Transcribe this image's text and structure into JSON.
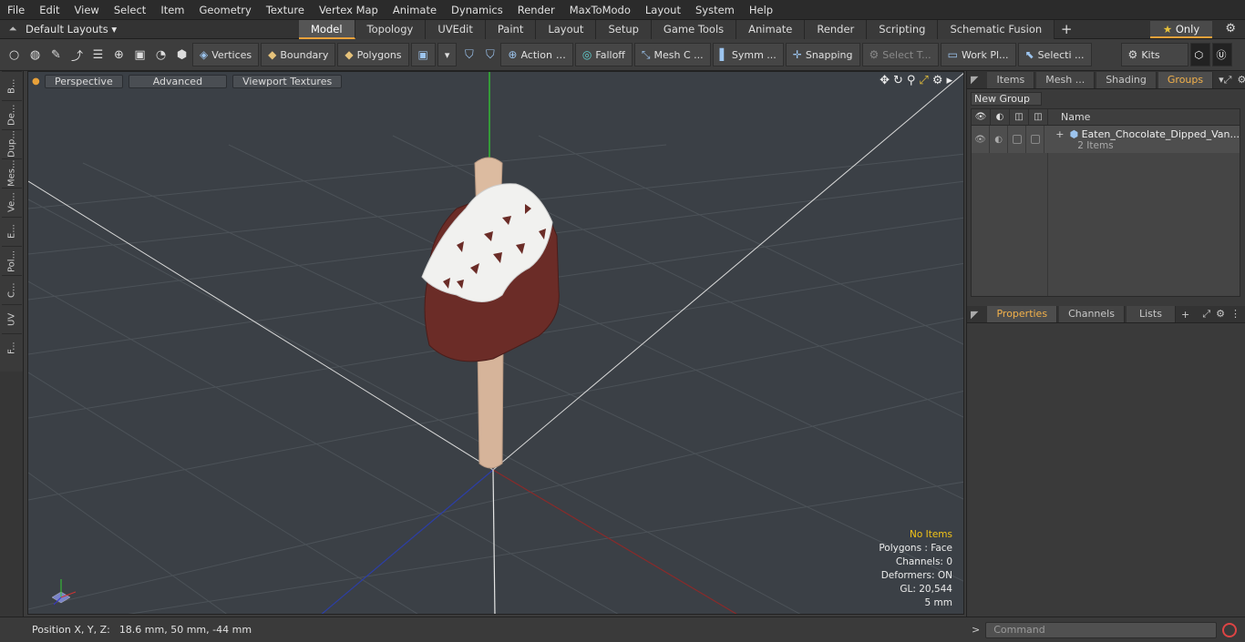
{
  "menu": [
    "File",
    "Edit",
    "View",
    "Select",
    "Item",
    "Geometry",
    "Texture",
    "Vertex Map",
    "Animate",
    "Dynamics",
    "Render",
    "MaxToModo",
    "Layout",
    "System",
    "Help"
  ],
  "layoutbar": {
    "layouts_label": "Default Layouts",
    "tabs": [
      "Model",
      "Topology",
      "UVEdit",
      "Paint",
      "Layout",
      "Setup",
      "Game Tools",
      "Animate",
      "Render",
      "Scripting",
      "Schematic Fusion"
    ],
    "active_tab": "Model",
    "only_label": "Only"
  },
  "toolbar": {
    "vertices": "Vertices",
    "boundary": "Boundary",
    "polygons": "Polygons",
    "action": "Action",
    "falloff": "Falloff",
    "mesh": "Mesh C ...",
    "symm": "Symm ...",
    "snapping": "Snapping",
    "select_t": "Select T...",
    "workpl": "Work Pl...",
    "selecti": "Selecti ...",
    "kits": "Kits"
  },
  "left_tabs": [
    "B...",
    "De...",
    "Dup...",
    "Mes...",
    "Ve...",
    "E...",
    "Pol...",
    "C...",
    "UV",
    "F..."
  ],
  "viewport": {
    "perspective": "Perspective",
    "advanced": "Advanced",
    "textures": "Viewport Textures",
    "info": {
      "items": "No Items",
      "polygons": "Polygons : Face",
      "channels": "Channels: 0",
      "deformers": "Deformers: ON",
      "gl": "GL: 20,544",
      "scale": "5 mm"
    }
  },
  "status": {
    "label": "Position X, Y, Z:",
    "value": "18.6 mm, 50 mm, -44 mm"
  },
  "right_top_tabs": [
    "Items",
    "Mesh ...",
    "Shading",
    "Groups"
  ],
  "right_top_active": "Groups",
  "groups": {
    "new_group": "New Group",
    "col_name": "Name",
    "item_name": "Eaten_Chocolate_Dipped_Van...",
    "item_count": "2 Items"
  },
  "right_bottom_tabs": [
    "Properties",
    "Channels",
    "Lists"
  ],
  "right_bottom_active": "Properties",
  "command": {
    "placeholder": "Command"
  },
  "colors": {
    "accent": "#e8a13a",
    "highlight_text": "#f2c318",
    "chocolate": "#6b2c27",
    "cream": "#f1f1ef",
    "stick": "#d6b49a"
  }
}
